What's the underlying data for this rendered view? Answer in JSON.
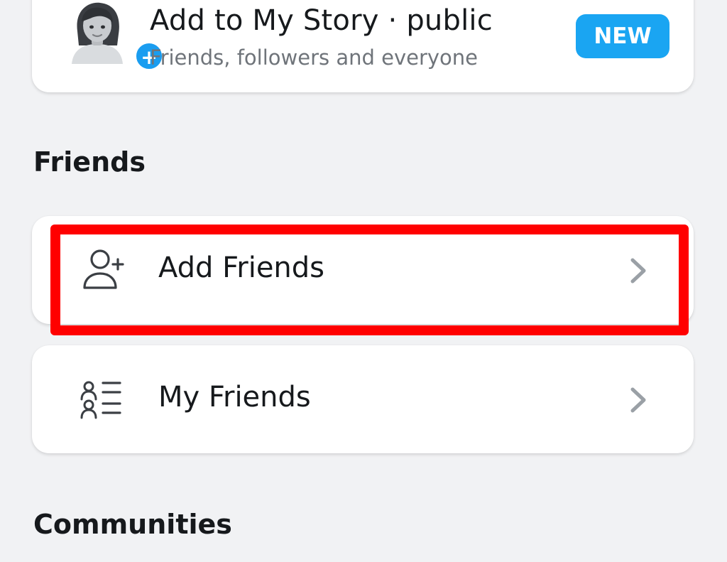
{
  "story": {
    "title": "Add to My Story · public",
    "subtitle": "Friends, followers and everyone",
    "badge": "NEW",
    "plus_glyph": "+"
  },
  "sections": {
    "friends": "Friends",
    "communities": "Communities"
  },
  "rows": {
    "add_friends": {
      "label": "Add Friends",
      "icon": "add-person-icon"
    },
    "my_friends": {
      "label": "My Friends",
      "icon": "friends-list-icon"
    }
  },
  "colors": {
    "accent": "#1aa5f2",
    "highlight": "#ff0000",
    "background": "#f1f2f4",
    "card": "#ffffff",
    "chevron": "#9aa0a6"
  }
}
